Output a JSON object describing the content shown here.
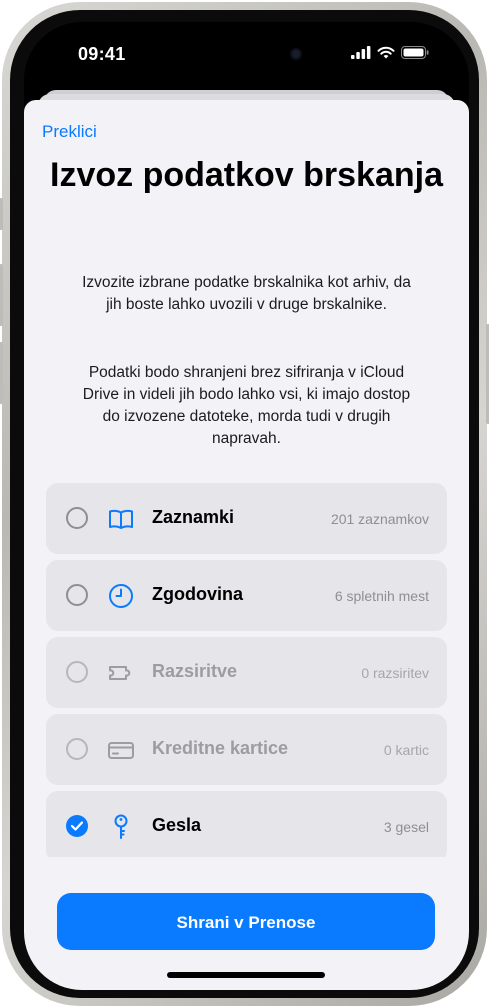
{
  "status_bar": {
    "time": "09:41"
  },
  "sheet": {
    "cancel_label": "Preklici",
    "title": "Izvoz podatkov brskanja",
    "description_1": "Izvozite izbrane podatke brskalnika kot arhiv, da jih boste lahko uvozili v druge brskalnike.",
    "description_2": "Podatki bodo shranjeni brez sifriranja v iCloud Drive in videli jih bodo lahko vsi, ki imajo dostop do izvozene datoteke, morda tudi v drugih napravah.",
    "items": [
      {
        "label": "Zaznamki",
        "count": "201 zaznamkov",
        "icon": "book-icon",
        "checked": false,
        "enabled": true
      },
      {
        "label": "Zgodovina",
        "count": "6 spletnih mest",
        "icon": "clock-icon",
        "checked": false,
        "enabled": true
      },
      {
        "label": "Razsiritve",
        "count": "0 razsiritev",
        "icon": "puzzle-icon",
        "checked": false,
        "enabled": false
      },
      {
        "label": "Kreditne kartice",
        "count": "0 kartic",
        "icon": "credit-card-icon",
        "checked": false,
        "enabled": false
      },
      {
        "label": "Gesla",
        "count": "3 gesel",
        "icon": "key-icon",
        "checked": true,
        "enabled": true
      }
    ],
    "save_label": "Shrani v Prenose"
  },
  "colors": {
    "accent": "#0a7aff",
    "sheet_background": "#f2f2f7",
    "row_background": "#e5e5ea",
    "secondary_text": "#8e8e93"
  }
}
